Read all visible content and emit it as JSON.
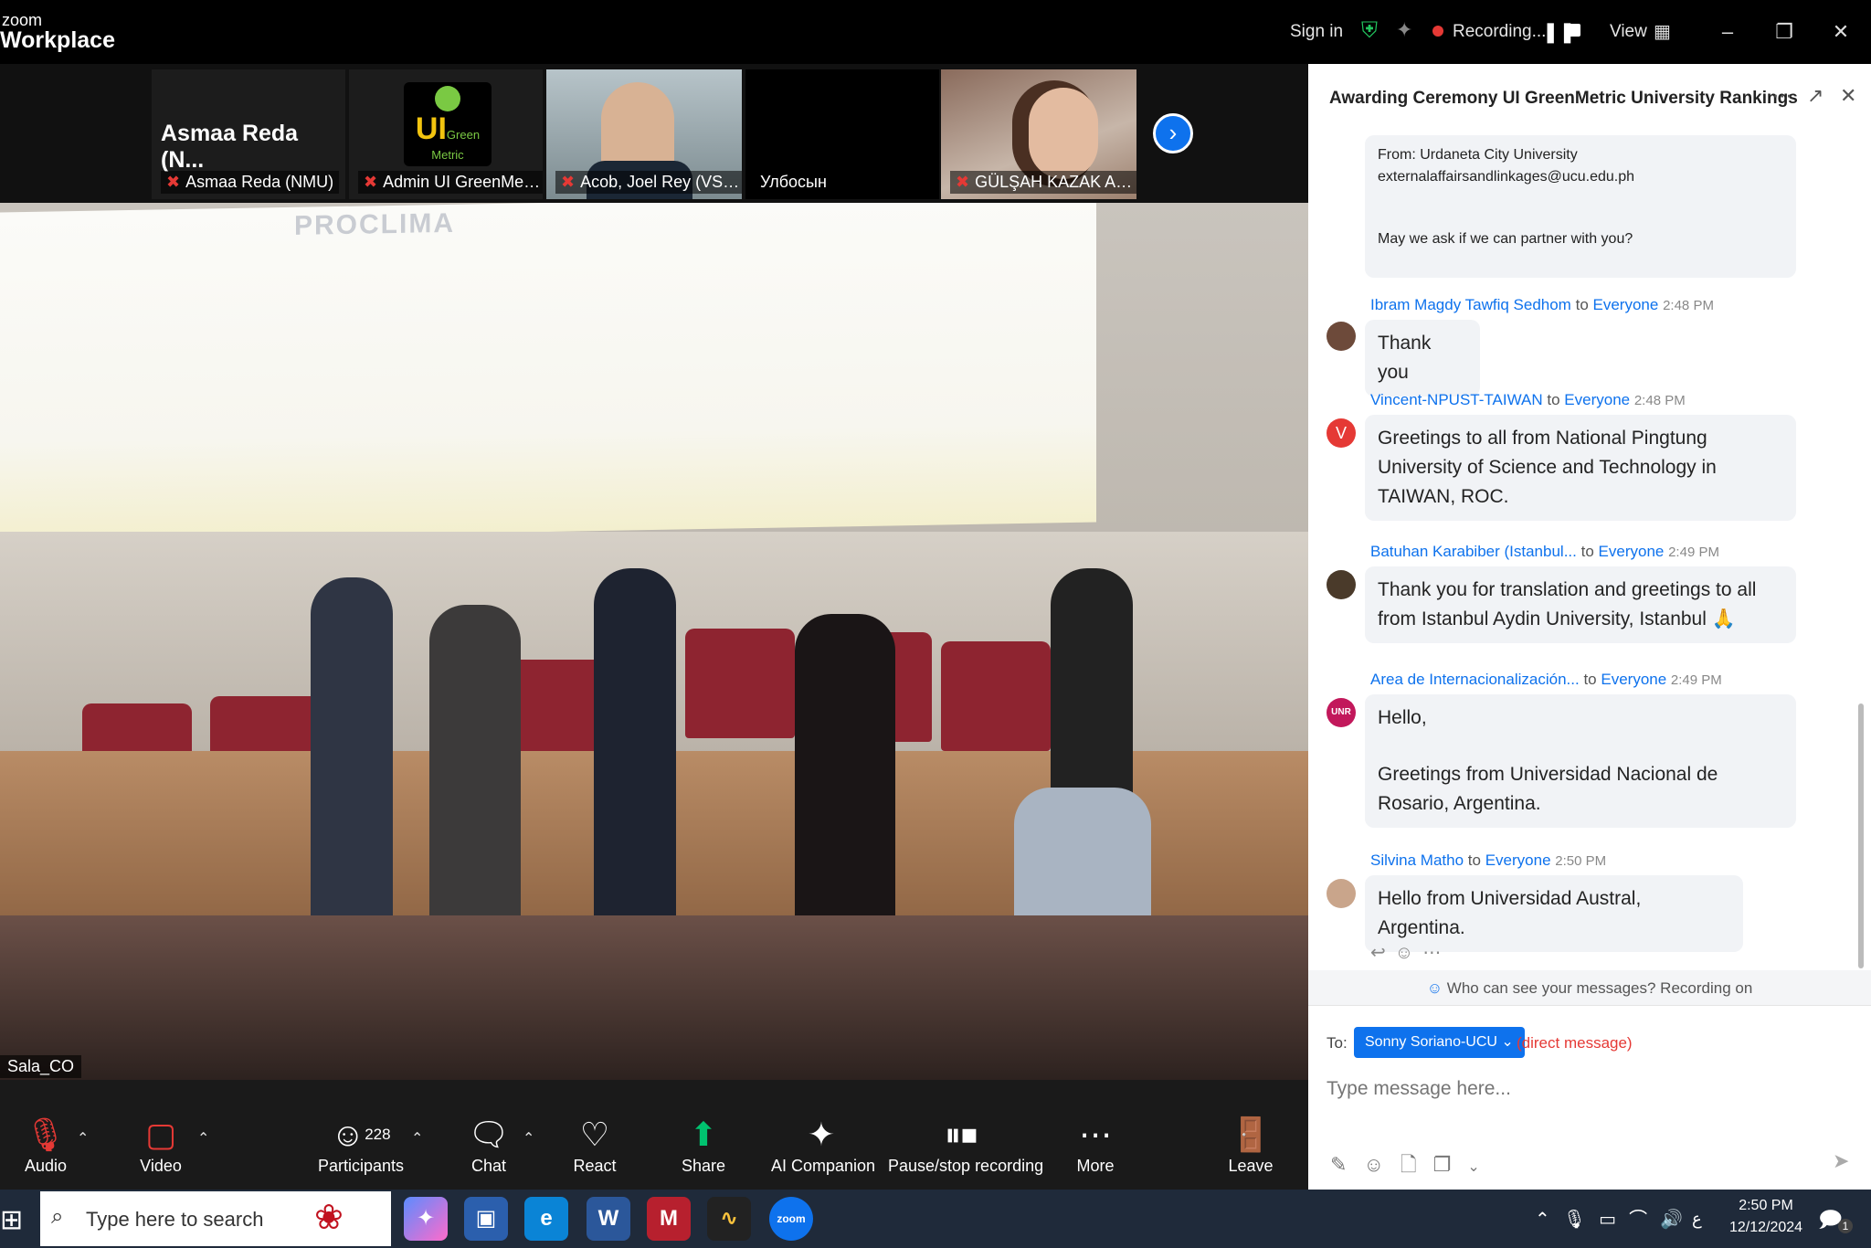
{
  "app": {
    "brand_top": "zoom",
    "brand_main": "Workplace"
  },
  "titlebar": {
    "sign_in": "Sign in",
    "recording": "Recording...",
    "view": "View"
  },
  "strip": {
    "tiles": [
      {
        "big_name": "Asmaa Reda (N...",
        "label": "Asmaa Reda (NMU)"
      },
      {
        "label": "Admin UI GreenMetric",
        "logo_big": "UI",
        "logo_small": "Green Metric"
      },
      {
        "label": "Acob, Joel Rey (VSU P..."
      },
      {
        "label": "Улбосын"
      },
      {
        "label": "GÜLŞAH KAZAK AFŞU ..."
      }
    ]
  },
  "video": {
    "overlay_text": "PROCLIMA",
    "label": "Sala_CO"
  },
  "toolbar": {
    "audio": "Audio",
    "video": "Video",
    "participants": "Participants",
    "participants_count": "228",
    "chat": "Chat",
    "react": "React",
    "share": "Share",
    "ai": "AI Companion",
    "record": "Pause/stop recording",
    "more": "More",
    "leave": "Leave"
  },
  "chat": {
    "title": "Awarding Ceremony UI GreenMetric University Rankings",
    "prev_message": {
      "line1": "From: Urdaneta City University",
      "line2": "externalaffairsandlinkages@ucu.edu.ph",
      "line3": "May we ask if we can partner with you?"
    },
    "messages": [
      {
        "sender": "Ibram Magdy Tawfiq Sedhom",
        "to": "to",
        "everyone": "Everyone",
        "time": "2:48 PM",
        "text": "Thank you"
      },
      {
        "sender": "Vincent-NPUST-TAIWAN",
        "to": "to",
        "everyone": "Everyone",
        "time": "2:48 PM",
        "avatar_letter": "V",
        "text": "Greetings to all from National Pingtung University of Science and Technology in TAIWAN, ROC."
      },
      {
        "sender": "Batuhan Karabiber (Istanbul...",
        "to": "to",
        "everyone": "Everyone",
        "time": "2:49 PM",
        "text": "Thank you for translation and greetings to all from Istanbul Aydin University, Istanbul 🙏"
      },
      {
        "sender": "Area de Internacionalización...",
        "to": "to",
        "everyone": "Everyone",
        "time": "2:49 PM",
        "avatar_letter": "UNR",
        "text_1": "Hello,",
        "text_2": "Greetings from Universidad Nacional de Rosario, Argentina."
      },
      {
        "sender": "Silvina Matho",
        "to": "to",
        "everyone": "Everyone",
        "time": "2:50 PM",
        "text": "Hello from Universidad Austral, Argentina."
      }
    ],
    "visibility_note": "Who can see your messages? Recording on",
    "to_label": "To:",
    "recipient": "Sonny Soriano-UCU",
    "direct": "(direct message)",
    "placeholder": "Type message here..."
  },
  "taskbar": {
    "search_placeholder": "Type here to search",
    "time": "2:50 PM",
    "date": "12/12/2024",
    "notif_count": "1",
    "lang": "ع"
  },
  "colors": {
    "accent": "#0e72ed",
    "record": "#e53935",
    "share": "#00c26f"
  }
}
